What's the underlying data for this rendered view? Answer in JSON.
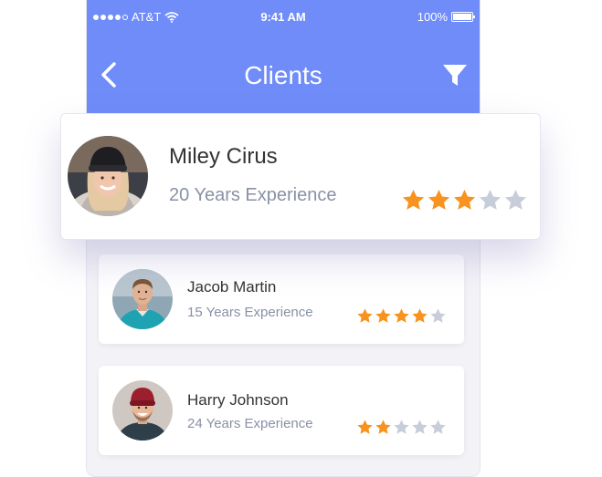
{
  "status_bar": {
    "carrier": "AT&T",
    "time": "9:41 AM",
    "battery": "100%"
  },
  "header": {
    "title": "Clients",
    "background": "#6f8cf8"
  },
  "colors": {
    "star_filled": "#f7931e",
    "star_empty": "#c7cdd9"
  },
  "clients": [
    {
      "name": "Miley Cirus",
      "experience": "20 Years Experience",
      "rating": 3,
      "max_rating": 5,
      "avatar": "avatar-woman-beanie"
    },
    {
      "name": "Jacob Martin",
      "experience": "15 Years Experience",
      "rating": 4,
      "max_rating": 5,
      "avatar": "avatar-man-teal-shirt"
    },
    {
      "name": "Harry Johnson",
      "experience": "24 Years Experience",
      "rating": 2,
      "max_rating": 5,
      "avatar": "avatar-man-red-beanie"
    }
  ]
}
